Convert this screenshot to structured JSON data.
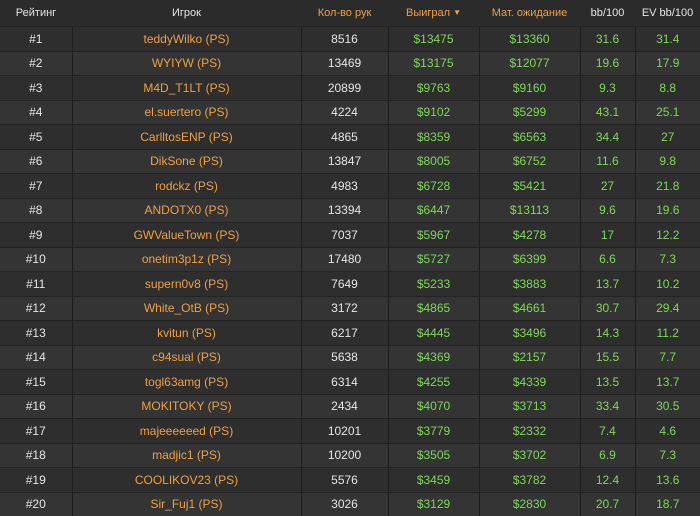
{
  "headers": {
    "rank": "Рейтинг",
    "player": "Игрок",
    "hands": "Кол-во рук",
    "won": "Выиграл",
    "ev": "Мат. ожидание",
    "bb100": "bb/100",
    "evbb100": "EV bb/100"
  },
  "rows": [
    {
      "rank": "#1",
      "player": "teddyWilko (PS)",
      "hands": "8516",
      "won": "$13475",
      "ev": "$13360",
      "bb100": "31.6",
      "evbb100": "31.4"
    },
    {
      "rank": "#2",
      "player": "WYIYW (PS)",
      "hands": "13469",
      "won": "$13175",
      "ev": "$12077",
      "bb100": "19.6",
      "evbb100": "17.9"
    },
    {
      "rank": "#3",
      "player": "M4D_T1LT (PS)",
      "hands": "20899",
      "won": "$9763",
      "ev": "$9160",
      "bb100": "9.3",
      "evbb100": "8.8"
    },
    {
      "rank": "#4",
      "player": "el.suertero (PS)",
      "hands": "4224",
      "won": "$9102",
      "ev": "$5299",
      "bb100": "43.1",
      "evbb100": "25.1"
    },
    {
      "rank": "#5",
      "player": "CarlltosENP (PS)",
      "hands": "4865",
      "won": "$8359",
      "ev": "$6563",
      "bb100": "34.4",
      "evbb100": "27"
    },
    {
      "rank": "#6",
      "player": "DikSone (PS)",
      "hands": "13847",
      "won": "$8005",
      "ev": "$6752",
      "bb100": "11.6",
      "evbb100": "9.8"
    },
    {
      "rank": "#7",
      "player": "rodckz (PS)",
      "hands": "4983",
      "won": "$6728",
      "ev": "$5421",
      "bb100": "27",
      "evbb100": "21.8"
    },
    {
      "rank": "#8",
      "player": "ANDOTX0 (PS)",
      "hands": "13394",
      "won": "$6447",
      "ev": "$13113",
      "bb100": "9.6",
      "evbb100": "19.6"
    },
    {
      "rank": "#9",
      "player": "GWValueTown (PS)",
      "hands": "7037",
      "won": "$5967",
      "ev": "$4278",
      "bb100": "17",
      "evbb100": "12.2"
    },
    {
      "rank": "#10",
      "player": "onetim3p1z (PS)",
      "hands": "17480",
      "won": "$5727",
      "ev": "$6399",
      "bb100": "6.6",
      "evbb100": "7.3"
    },
    {
      "rank": "#11",
      "player": "supern0v8 (PS)",
      "hands": "7649",
      "won": "$5233",
      "ev": "$3883",
      "bb100": "13.7",
      "evbb100": "10.2"
    },
    {
      "rank": "#12",
      "player": "White_OtB (PS)",
      "hands": "3172",
      "won": "$4865",
      "ev": "$4661",
      "bb100": "30.7",
      "evbb100": "29.4"
    },
    {
      "rank": "#13",
      "player": "kvitun (PS)",
      "hands": "6217",
      "won": "$4445",
      "ev": "$3496",
      "bb100": "14.3",
      "evbb100": "11.2"
    },
    {
      "rank": "#14",
      "player": "c94sual (PS)",
      "hands": "5638",
      "won": "$4369",
      "ev": "$2157",
      "bb100": "15.5",
      "evbb100": "7.7"
    },
    {
      "rank": "#15",
      "player": "togl63amg (PS)",
      "hands": "6314",
      "won": "$4255",
      "ev": "$4339",
      "bb100": "13.5",
      "evbb100": "13.7"
    },
    {
      "rank": "#16",
      "player": "MOKITOKY (PS)",
      "hands": "2434",
      "won": "$4070",
      "ev": "$3713",
      "bb100": "33.4",
      "evbb100": "30.5"
    },
    {
      "rank": "#17",
      "player": "majeeeeeed (PS)",
      "hands": "10201",
      "won": "$3779",
      "ev": "$2332",
      "bb100": "7.4",
      "evbb100": "4.6"
    },
    {
      "rank": "#18",
      "player": "madjic1 (PS)",
      "hands": "10200",
      "won": "$3505",
      "ev": "$3702",
      "bb100": "6.9",
      "evbb100": "7.3"
    },
    {
      "rank": "#19",
      "player": "COOLIKOV23 (PS)",
      "hands": "5576",
      "won": "$3459",
      "ev": "$3782",
      "bb100": "12.4",
      "evbb100": "13.6"
    },
    {
      "rank": "#20",
      "player": "Sir_Fuj1 (PS)",
      "hands": "3026",
      "won": "$3129",
      "ev": "$2830",
      "bb100": "20.7",
      "evbb100": "18.7"
    }
  ],
  "icons": {
    "sort": "caret-down-icon"
  },
  "colors": {
    "background": "#2b2b2b",
    "row_odd": "#2e2e2e",
    "row_even": "#343434",
    "accent_orange": "#f0a040",
    "positive_green": "#7ed957",
    "text": "#e6e6e6"
  }
}
